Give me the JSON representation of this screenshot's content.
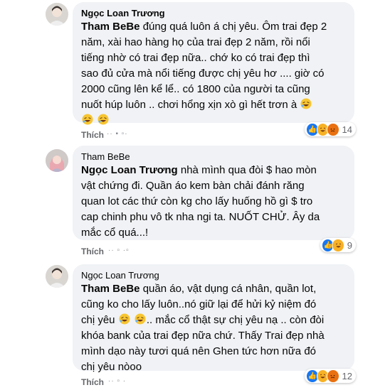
{
  "comments": [
    {
      "author": "Ngọc Loan Trương",
      "mention": "Tham BeBe",
      "lines": [
        "đúng quá luôn á chị yêu. Ôm trai đẹp 2",
        "năm, xài hao hàng họ của trai đẹp 2 năm, rồi nổi",
        "tiếng nhờ có trai đẹp nữa.. chớ ko có trai đẹp thì",
        "sao đủ cửa mà nổi tiếng được chị yêu hơ .... giờ có",
        "2000 cũng lên kể lể.. có 1800 của người ta cũng",
        "nuốt húp luôn .. chơi hổng xịn xò gì hết trơn à"
      ],
      "emoji": [
        "rofl-emoji",
        "rofl-emoji",
        "rofl-emoji"
      ],
      "action": "Thích",
      "reaction_count": "14",
      "reactions": [
        "like-reaction",
        "haha-reaction",
        "angry-reaction"
      ]
    },
    {
      "author": "Tham BeBe",
      "mention": "Ngọc Loan Trương",
      "lines": [
        "nhà mình qua đòi $ hao mòn",
        "vật chứng đi. Quần áo kem bàn chải đánh răng",
        "quan lot các thứ còn kg cho lấy huống hồ gì $ tro",
        "cap chinh phu vô tk nha ngi ta. NUỐT CHỬ. Ây da",
        "mắc cổ quá...!"
      ],
      "action": "Thích",
      "reaction_count": "9",
      "reactions": [
        "like-reaction",
        "haha-reaction"
      ]
    },
    {
      "author": "Ngọc Loan Trương",
      "mention": "Tham BeBe",
      "lines": [
        "quần áo, vật dụng cá nhân, quần lot,",
        "cũng ko cho lấy luôn..nó giữ lại để hửi kỷ niệm đó",
        "chị yêu",
        "mắc cổ thật sự chị yêu nạ .. còn đòi",
        "khóa bank của trai đẹp nữa chứ. Thấy Trai đẹp nhà",
        "mình dạo này tươi quá nên Ghen tức hơn nữa đó",
        "chị yêu nòoo"
      ],
      "action": "Thích",
      "reaction_count": "12",
      "reactions": [
        "like-reaction",
        "haha-reaction",
        "angry-reaction"
      ]
    }
  ],
  "colors": {
    "bubble": "#f0f2f5",
    "secondary_text": "#65676b",
    "like": "#1877f2",
    "haha": "#f7b125",
    "angry": "#e9710f"
  }
}
